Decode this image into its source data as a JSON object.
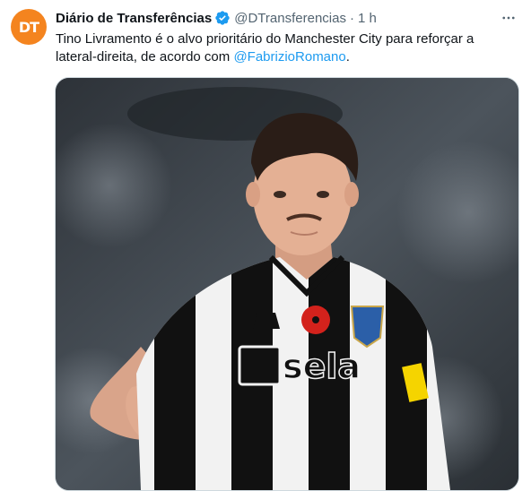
{
  "author": {
    "name": "Diário de Transferências",
    "handle": "@DTransferencias",
    "time": "1 h",
    "avatar_letters": "DT",
    "avatar_color": "#f4841f",
    "verified_icon": "verified-badge-icon"
  },
  "tweet": {
    "text_before": "Tino Livramento é o alvo prioritário do Manchester City para reforçar a lateral-direita, de acordo com ",
    "mention": "@FabrizioRomano",
    "text_after": "."
  },
  "media": {
    "kit_sponsor": "sela"
  },
  "colors": {
    "accent": "#1d9bf0",
    "secondary_text": "#536471",
    "avatar_bg": "#f4841f"
  },
  "icons": [
    "verified-badge-icon",
    "more-options-icon"
  ]
}
